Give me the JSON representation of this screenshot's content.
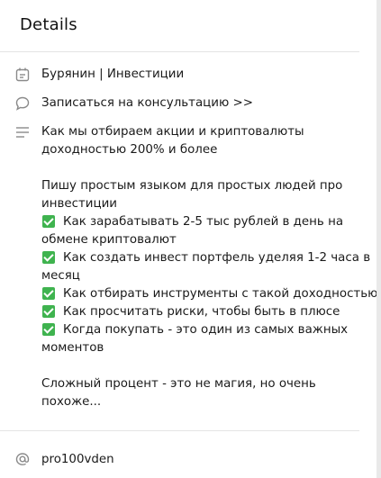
{
  "header": {
    "title": "Details"
  },
  "channel": {
    "name": "Бурянин | Инвестиции",
    "icon": "channel-icon"
  },
  "consult_link": {
    "label": "Записаться на консультацию >>",
    "icon": "comment-icon"
  },
  "description": {
    "icon": "text-lines-icon",
    "lines": [
      "Как мы отбираем акции и криптовалюты",
      "доходностью 200% и более",
      "",
      "Пишу простым языком для простых людей про",
      "инвестиции",
      "Как зарабатывать 2-5 тыс рублей в день на",
      "обмене криптовалют",
      "Как создать инвест портфель уделяя 1-2 часа в",
      "месяц",
      "Как отбирать инструменты с такой доходностью",
      "Как просчитать риски, чтобы быть в плюсе",
      "Когда покупать - это один из самых важных",
      "моментов",
      "",
      "Сложный процент - это не магия, но очень",
      "похоже..."
    ]
  },
  "username": {
    "value": "pro100vden",
    "icon": "at-sign-icon"
  },
  "colors": {
    "check": "#3fb34f",
    "icon": "#8a8a8a",
    "divider": "#e4e4e4"
  }
}
